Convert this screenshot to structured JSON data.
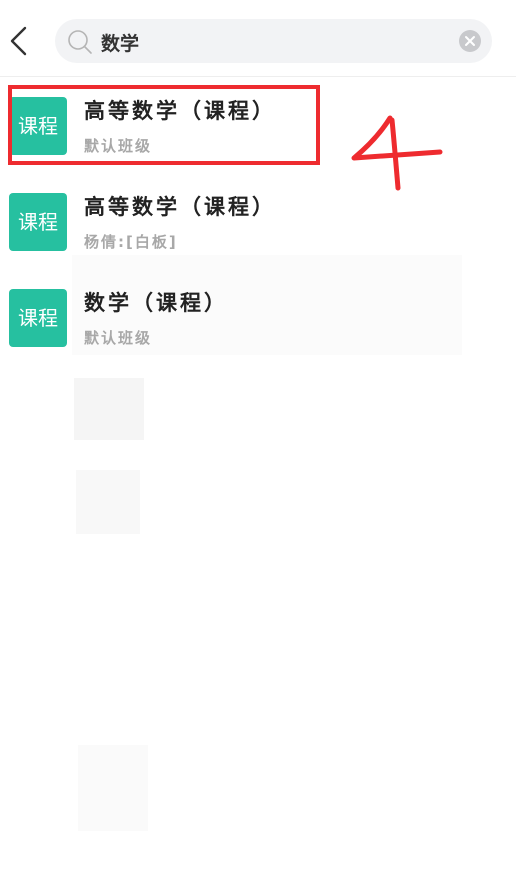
{
  "search": {
    "value": "数学",
    "placeholder": ""
  },
  "results": [
    {
      "badge": "课程",
      "title": "高等数学（课程）",
      "subtitle": "默认班级"
    },
    {
      "badge": "课程",
      "title": "高等数学（课程）",
      "subtitle": "杨倩:[白板]"
    },
    {
      "badge": "课程",
      "title": "数学（课程）",
      "subtitle": "默认班级"
    }
  ],
  "annotation": {
    "label": "4",
    "color": "#ee2b2f"
  },
  "colors": {
    "badge": "#26c0a0",
    "highlight": "#ee2b2f"
  }
}
